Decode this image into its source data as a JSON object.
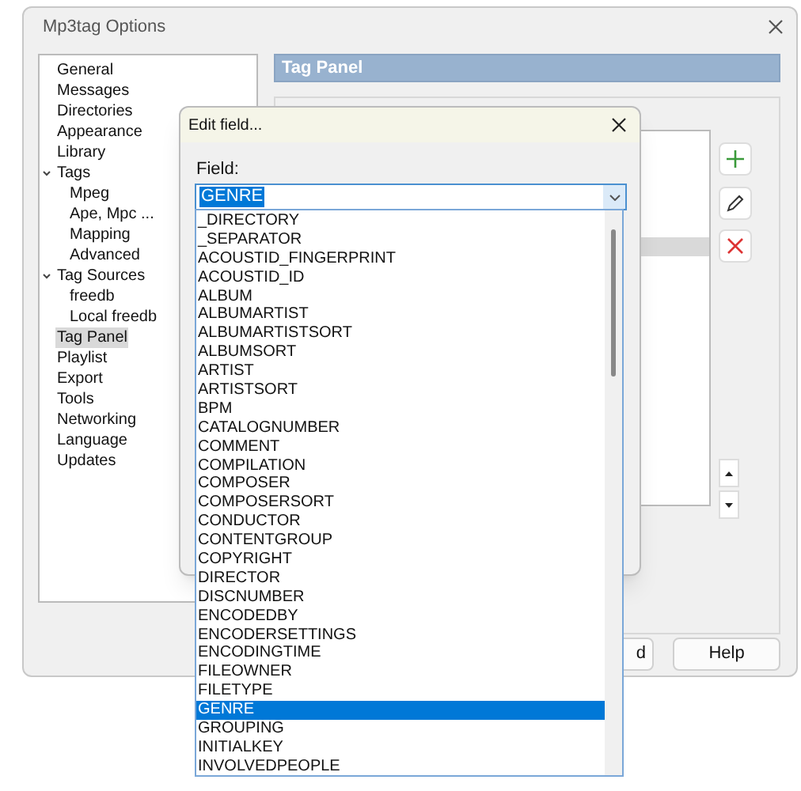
{
  "window": {
    "title": "Mp3tag Options"
  },
  "tree": [
    {
      "label": "General",
      "selected": false
    },
    {
      "label": "Messages",
      "selected": false
    },
    {
      "label": "Directories",
      "selected": false
    },
    {
      "label": "Appearance",
      "selected": false
    },
    {
      "label": "Library",
      "selected": false
    },
    {
      "label": "Tags",
      "selected": false,
      "expanded": true,
      "children": [
        {
          "label": "Mpeg",
          "selected": false
        },
        {
          "label": "Ape, Mpc ...",
          "selected": false
        },
        {
          "label": "Mapping",
          "selected": false
        },
        {
          "label": "Advanced",
          "selected": false
        }
      ]
    },
    {
      "label": "Tag Sources",
      "selected": false,
      "expanded": true,
      "children": [
        {
          "label": "freedb",
          "selected": false
        },
        {
          "label": "Local freedb",
          "selected": false
        }
      ]
    },
    {
      "label": "Tag Panel",
      "selected": true
    },
    {
      "label": "Playlist",
      "selected": false
    },
    {
      "label": "Export",
      "selected": false
    },
    {
      "label": "Tools",
      "selected": false
    },
    {
      "label": "Networking",
      "selected": false
    },
    {
      "label": "Language",
      "selected": false
    },
    {
      "label": "Updates",
      "selected": false
    }
  ],
  "panel": {
    "title": "Tag Panel"
  },
  "footer_buttons": [
    "d",
    "Help"
  ],
  "dialog": {
    "title": "Edit field...",
    "field_label": "Field:",
    "field_value": "GENRE",
    "options": [
      {
        "label": "_DIRECTORY",
        "selected": false
      },
      {
        "label": "_SEPARATOR",
        "selected": false
      },
      {
        "label": "ACOUSTID_FINGERPRINT",
        "selected": false
      },
      {
        "label": "ACOUSTID_ID",
        "selected": false
      },
      {
        "label": "ALBUM",
        "selected": false
      },
      {
        "label": "ALBUMARTIST",
        "selected": false
      },
      {
        "label": "ALBUMARTISTSORT",
        "selected": false
      },
      {
        "label": "ALBUMSORT",
        "selected": false
      },
      {
        "label": "ARTIST",
        "selected": false
      },
      {
        "label": "ARTISTSORT",
        "selected": false
      },
      {
        "label": "BPM",
        "selected": false
      },
      {
        "label": "CATALOGNUMBER",
        "selected": false
      },
      {
        "label": "COMMENT",
        "selected": false
      },
      {
        "label": "COMPILATION",
        "selected": false
      },
      {
        "label": "COMPOSER",
        "selected": false
      },
      {
        "label": "COMPOSERSORT",
        "selected": false
      },
      {
        "label": "CONDUCTOR",
        "selected": false
      },
      {
        "label": "CONTENTGROUP",
        "selected": false
      },
      {
        "label": "COPYRIGHT",
        "selected": false
      },
      {
        "label": "DIRECTOR",
        "selected": false
      },
      {
        "label": "DISCNUMBER",
        "selected": false
      },
      {
        "label": "ENCODEDBY",
        "selected": false
      },
      {
        "label": "ENCODERSETTINGS",
        "selected": false
      },
      {
        "label": "ENCODINGTIME",
        "selected": false
      },
      {
        "label": "FILEOWNER",
        "selected": false
      },
      {
        "label": "FILETYPE",
        "selected": false
      },
      {
        "label": "GENRE",
        "selected": true
      },
      {
        "label": "GROUPING",
        "selected": false
      },
      {
        "label": "INITIALKEY",
        "selected": false
      },
      {
        "label": "INVOLVEDPEOPLE",
        "selected": false
      }
    ]
  }
}
